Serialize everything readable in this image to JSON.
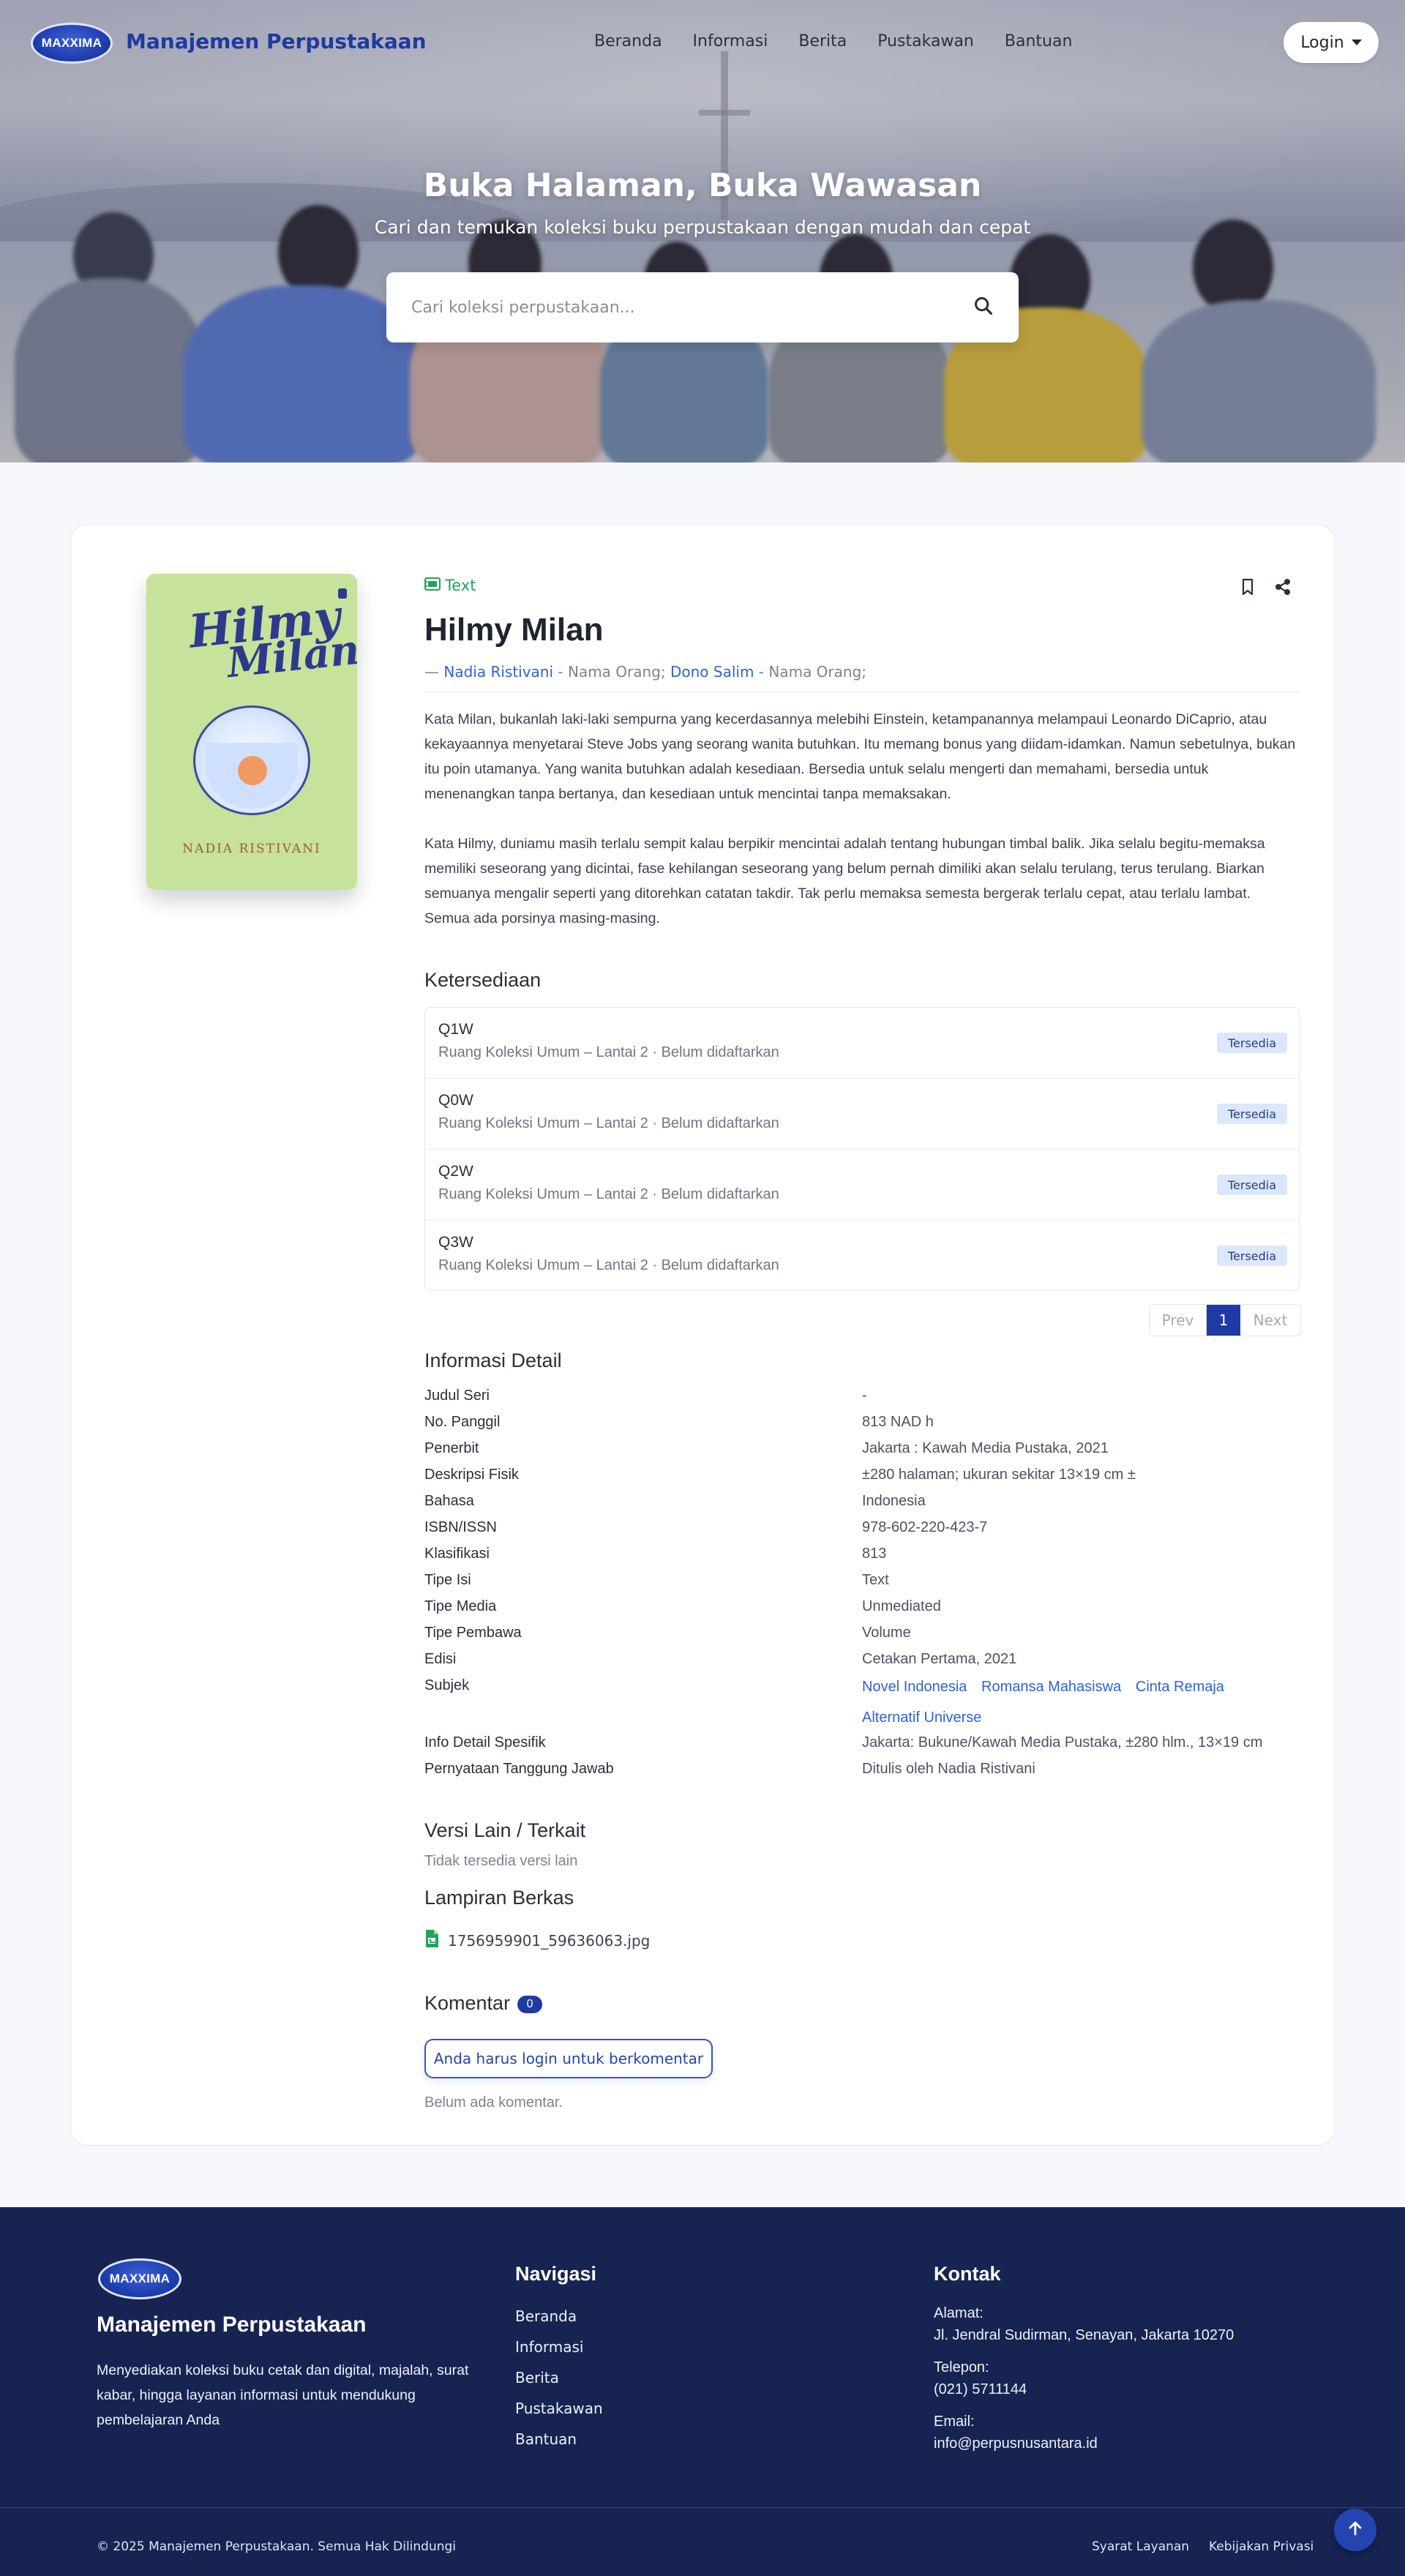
{
  "nav": {
    "logo_text": "MAXXIMA",
    "brand": "Manajemen Perpustakaan",
    "menu": [
      "Beranda",
      "Informasi",
      "Berita",
      "Pustakawan",
      "Bantuan"
    ],
    "login_label": "Login"
  },
  "hero": {
    "title": "Buka Halaman, Buka Wawasan",
    "subtitle": "Cari dan temukan koleksi buku perpustakaan dengan mudah dan cepat",
    "search_placeholder": "Cari koleksi perpustakaan..."
  },
  "book": {
    "cover_title_1": "Hilmy",
    "cover_title_2": "Milan",
    "cover_author": "Nadia Ristivani",
    "type": "Text",
    "title": "Hilmy Milan",
    "author_prefix": "— ",
    "author_1": "Nadia Ristivani",
    "author_1_role": " - Nama Orang; ",
    "author_2": "Dono Salim",
    "author_2_role": " - Nama Orang;",
    "description": [
      "Kata Milan, bukanlah laki-laki sempurna yang kecerdasannya melebihi Einstein, ketampanannya melampaui Leonardo DiCaprio, atau kekayaannya menyetarai Steve Jobs yang seorang wanita butuhkan. Itu memang bonus yang diidam-idamkan. Namun sebetulnya, bukan itu poin utamanya. Yang wanita butuhkan adalah kesediaan. Bersedia untuk selalu mengerti dan memahami, bersedia untuk menenangkan tanpa bertanya, dan kesediaan untuk mencintai tanpa memaksakan.",
      "Kata Hilmy, duniamu masih terlalu sempit kalau berpikir mencintai adalah tentang hubungan timbal balik. Jika selalu begitu-memaksa memiliki seseorang yang dicintai, fase kehilangan seseorang yang belum pernah dimiliki akan selalu terulang, terus terulang. Biarkan semuanya mengalir seperti yang ditorehkan catatan takdir. Tak perlu memaksa semesta bergerak terlalu cepat, atau terlalu lambat. Semua ada porsinya masing-masing."
    ]
  },
  "availability": {
    "heading": "Ketersediaan",
    "items": [
      {
        "code": "Q1W",
        "location": "Ruang Koleksi Umum – Lantai 2 · Belum didaftarkan",
        "status": "Tersedia"
      },
      {
        "code": "Q0W",
        "location": "Ruang Koleksi Umum – Lantai 2 · Belum didaftarkan",
        "status": "Tersedia"
      },
      {
        "code": "Q2W",
        "location": "Ruang Koleksi Umum – Lantai 2 · Belum didaftarkan",
        "status": "Tersedia"
      },
      {
        "code": "Q3W",
        "location": "Ruang Koleksi Umum – Lantai 2 · Belum didaftarkan",
        "status": "Tersedia"
      }
    ],
    "pager": {
      "prev": "Prev",
      "page": "1",
      "next": "Next"
    }
  },
  "detail": {
    "heading": "Informasi Detail",
    "rows": [
      {
        "label": "Judul Seri",
        "value": "-"
      },
      {
        "label": "No. Panggil",
        "value": "813 NAD h"
      },
      {
        "label": "Penerbit",
        "value": "Jakarta : Kawah Media Pustaka, 2021"
      },
      {
        "label": "Deskripsi Fisik",
        "value": "±280 halaman; ukuran sekitar 13×19 cm ±"
      },
      {
        "label": "Bahasa",
        "value": "Indonesia"
      },
      {
        "label": "ISBN/ISSN",
        "value": "978-602-220-423-7"
      },
      {
        "label": "Klasifikasi",
        "value": "813"
      },
      {
        "label": "Tipe Isi",
        "value": "Text"
      },
      {
        "label": "Tipe Media",
        "value": "Unmediated"
      },
      {
        "label": "Tipe Pembawa",
        "value": "Volume"
      },
      {
        "label": "Edisi",
        "value": "Cetakan Pertama, 2021"
      }
    ],
    "subject_label": "Subjek",
    "subjects": [
      "Novel Indonesia",
      "Romansa Mahasiswa",
      "Cinta Remaja",
      "Alternatif Universe"
    ],
    "rows_after": [
      {
        "label": "Info Detail Spesifik",
        "value": "Jakarta: Bukune/Kawah Media Pustaka, ±280 hlm., 13×19 cm"
      },
      {
        "label": "Pernyataan Tanggung Jawab",
        "value": "Ditulis oleh Nadia Ristivani"
      }
    ]
  },
  "versions": {
    "heading": "Versi Lain / Terkait",
    "empty": "Tidak tersedia versi lain"
  },
  "attachments": {
    "heading": "Lampiran Berkas",
    "file": "1756959901_59636063.jpg"
  },
  "comments": {
    "heading": "Komentar",
    "count": "0",
    "login_prompt": "Anda harus login untuk berkomentar",
    "empty": "Belum ada komentar."
  },
  "footer": {
    "logo_text": "MAXXIMA",
    "brand": "Manajemen Perpustakaan",
    "description": "Menyediakan koleksi buku cetak dan digital, majalah, surat kabar, hingga layanan informasi untuk mendukung pembelajaran Anda",
    "nav_heading": "Navigasi",
    "nav": [
      "Beranda",
      "Informasi",
      "Berita",
      "Pustakawan",
      "Bantuan"
    ],
    "contact_heading": "Kontak",
    "address_label": "Alamat:",
    "address": "Jl. Jendral Sudirman, Senayan, Jakarta 10270",
    "phone_label": "Telepon:",
    "phone": "(021) 5711144",
    "email_label": "Email:",
    "email": "info@perpusnusantara.id",
    "copyright": "© 2025 Manajemen Perpustakaan. Semua Hak Dilindungi",
    "terms": "Syarat Layanan",
    "privacy": "Kebijakan Privasi"
  },
  "colors": {
    "primary": "#1f3aa5",
    "link": "#2f62d6",
    "success": "#22a55a",
    "footer": "#172452",
    "badge_bg": "#dbe7fa"
  },
  "icons": [
    "search-icon",
    "chevron-down-icon",
    "book-type-icon",
    "bookmark-icon",
    "share-icon",
    "file-image-icon",
    "arrow-up-icon"
  ]
}
